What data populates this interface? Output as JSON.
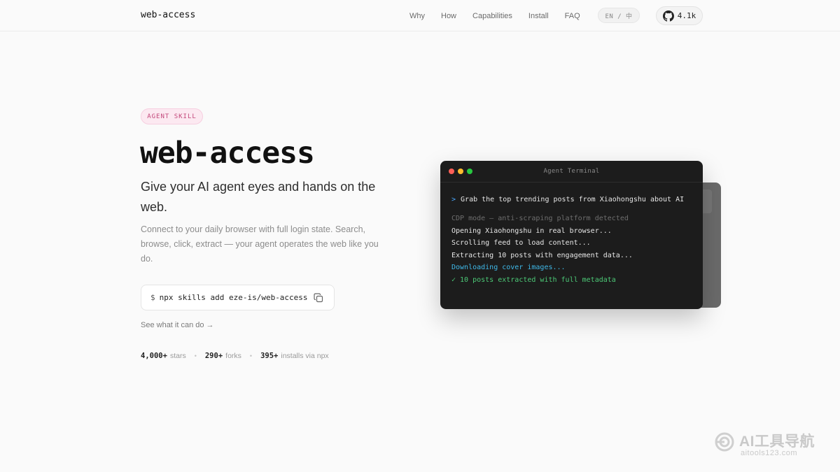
{
  "nav": {
    "brand": "web-access",
    "links": [
      "Why",
      "How",
      "Capabilities",
      "Install",
      "FAQ"
    ],
    "lang": "EN / 中",
    "github": {
      "icon": "github-icon",
      "stars": "4.1k"
    }
  },
  "hero": {
    "badge": "AGENT SKILL",
    "title": "web-access",
    "subtitle": "Give your AI agent eyes and hands on the web.",
    "description": "Connect to your daily browser with full login state. Search, browse, click, extract — your agent operates the web like you do.",
    "command": {
      "prompt": "$",
      "text": "npx skills add eze-is/web-access",
      "copy_icon": "copy-icon"
    },
    "see_link": "See what it can do →",
    "stats": [
      {
        "num": "4,000+",
        "label": "stars"
      },
      {
        "num": "290+",
        "label": "forks"
      },
      {
        "num": "395+",
        "label": "installs via npx"
      }
    ]
  },
  "terminal": {
    "title": "Agent Terminal",
    "lights": [
      "#ff5f57",
      "#febc2e",
      "#28c840"
    ],
    "prompt_caret": ">",
    "prompt": "Grab the top trending posts from Xiaohongshu about AI",
    "lines": [
      {
        "text": "CDP mode — anti-scraping platform detected",
        "color": "#6e6e6e"
      },
      {
        "text": "Opening Xiaohongshu in real browser...",
        "color": "#e6e6e6"
      },
      {
        "text": "Scrolling feed to load content...",
        "color": "#e6e6e6"
      },
      {
        "text": "Extracting 10 posts with engagement data...",
        "color": "#e6e6e6"
      },
      {
        "text": "Downloading cover images...",
        "color": "#3fb8e8"
      },
      {
        "text": "✓ 10 posts extracted with full metadata",
        "color": "#4cc876"
      }
    ]
  },
  "watermark": {
    "title": "AI工具导航",
    "subtitle": "aitools123.com"
  }
}
